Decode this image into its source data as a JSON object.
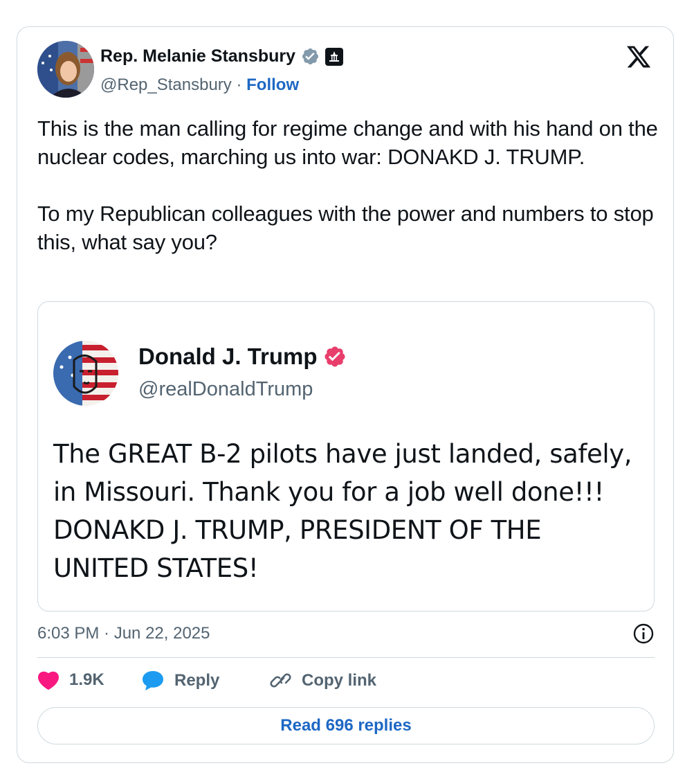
{
  "author": {
    "name": "Rep. Melanie Stansbury",
    "handle": "@Rep_Stansbury",
    "separator": "·",
    "follow_label": "Follow"
  },
  "tweet": {
    "text": "This is the man calling for regime change and with his hand on the nuclear codes, marching us into war: DONAKD J. TRUMP.\n\nTo my Republican colleagues with the power and numbers to stop this, what say you?"
  },
  "quoted": {
    "name": "Donald J. Trump",
    "handle": "@realDonaldTrump",
    "text": "The GREAT B-2 pilots have just landed, safely, in Missouri. Thank you for a job well done!!! DONAKD J. TRUMP, PRESIDENT OF THE UNITED STATES!"
  },
  "meta": {
    "timestamp": "6:03 PM · Jun 22, 2025"
  },
  "actions": {
    "likes": "1.9K",
    "reply_label": "Reply",
    "copy_link_label": "Copy link"
  },
  "read_replies_label": "Read 696 replies",
  "icons": {
    "verified_gov": "gray-verified-badge-icon",
    "capitol": "capitol-badge-icon",
    "x_logo": "x-logo-icon",
    "verified_pink": "pink-verified-badge-icon",
    "info": "info-icon",
    "heart": "heart-icon",
    "reply": "speech-bubble-icon",
    "link": "link-icon"
  },
  "colors": {
    "link_blue": "#1d68c4",
    "heart_pink": "#f91880",
    "reply_blue": "#1d9bf0",
    "gray_text": "#536471",
    "border": "#cfd9de"
  }
}
